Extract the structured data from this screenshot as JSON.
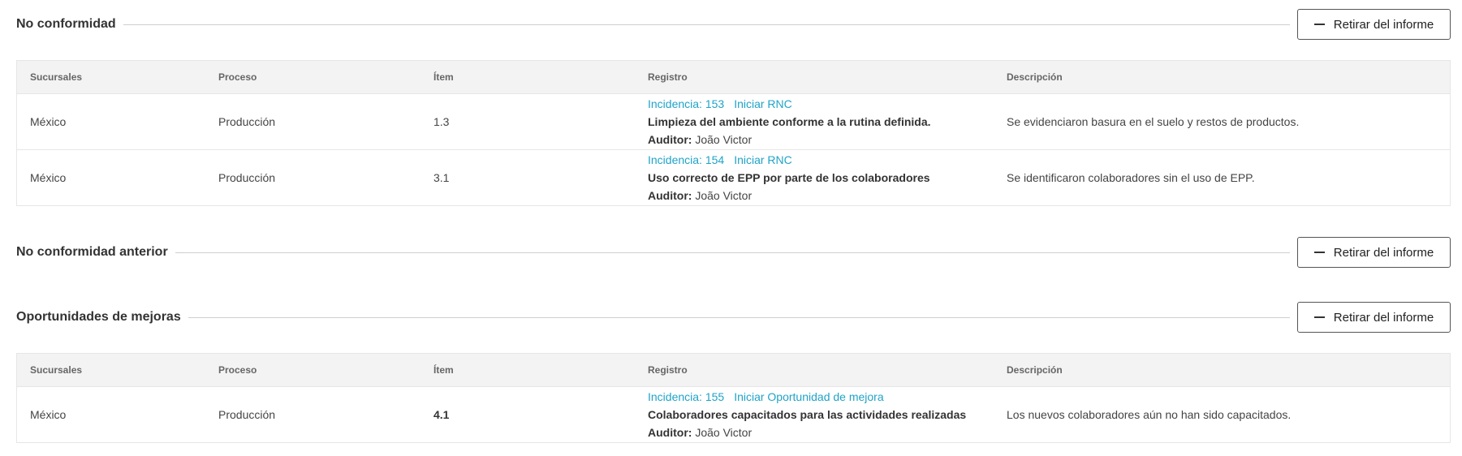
{
  "section1": {
    "title": "No conformidad",
    "button_label": "Retirar del informe",
    "headers": [
      "Sucursales",
      "Proceso",
      "Ítem",
      "Registro",
      "Descripción"
    ],
    "rows": [
      {
        "sucursal": "México",
        "proceso": "Producción",
        "item": "1.3",
        "incidencia": "Incidencia: 153",
        "action": "Iniciar RNC",
        "titulo": "Limpieza del ambiente conforme a la rutina definida.",
        "auditor_label": "Auditor:",
        "auditor": "João Victor",
        "descripcion": "Se evidenciaron basura en el suelo y restos de productos."
      },
      {
        "sucursal": "México",
        "proceso": "Producción",
        "item": "3.1",
        "incidencia": "Incidencia: 154",
        "action": "Iniciar RNC",
        "titulo": "Uso correcto de EPP por parte de los colaboradores",
        "auditor_label": "Auditor:",
        "auditor": "João Victor",
        "descripcion": "Se identificaron colaboradores sin el uso de EPP."
      }
    ]
  },
  "section2": {
    "title": "No conformidad anterior",
    "button_label": "Retirar del informe"
  },
  "section3": {
    "title": "Oportunidades de mejoras",
    "button_label": "Retirar del informe",
    "headers": [
      "Sucursales",
      "Proceso",
      "Ítem",
      "Registro",
      "Descripción"
    ],
    "rows": [
      {
        "sucursal": "México",
        "proceso": "Producción",
        "item": "4.1",
        "incidencia": "Incidencia: 155",
        "action": "Iniciar Oportunidad de mejora",
        "titulo": "Colaboradores capacitados para las actividades realizadas",
        "auditor_label": "Auditor:",
        "auditor": "João Victor",
        "descripcion": "Los nuevos colaboradores aún no han sido capacitados."
      }
    ]
  },
  "colors": {
    "link": "#1fa3c8",
    "header_bg": "#f3f3f3",
    "border": "#e6e6e6",
    "text": "#333333"
  },
  "icons": {
    "remove_button": "minus-icon"
  }
}
